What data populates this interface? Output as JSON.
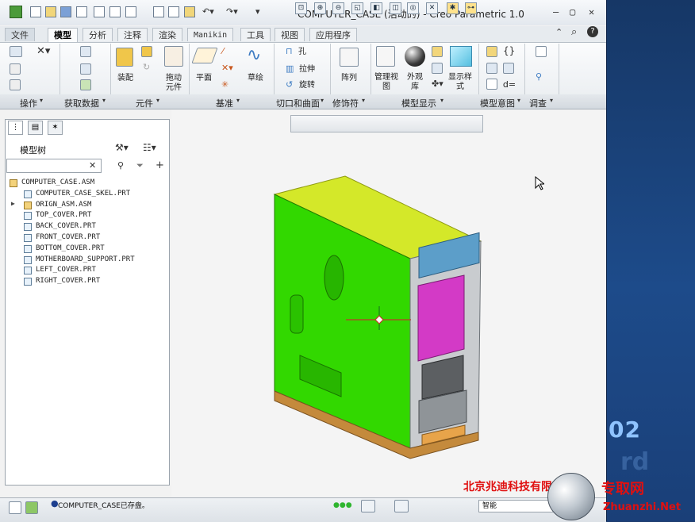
{
  "window": {
    "title": "COMPUTER_CASE (活动的) - Creo Parametric 1.0",
    "controls": [
      "—",
      "▢",
      "✕"
    ]
  },
  "tabs": [
    {
      "label": "文件",
      "active": false
    },
    {
      "label": "模型",
      "active": true
    },
    {
      "label": "分析",
      "active": false
    },
    {
      "label": "注释",
      "active": false
    },
    {
      "label": "渲染",
      "active": false
    },
    {
      "label": "Manikin",
      "active": false
    },
    {
      "label": "工具",
      "active": false
    },
    {
      "label": "视图",
      "active": false
    },
    {
      "label": "应用程序",
      "active": false
    }
  ],
  "ribbon": {
    "buttons": {
      "assemble": "装配",
      "drag": "拖动\n元件",
      "plane": "平面",
      "sketch": "草绘",
      "hole": "孔",
      "extrude": "拉伸",
      "revolve": "旋转",
      "pattern": "阵列",
      "manage_views": "管理视\n图",
      "appearance": "外观\n库",
      "display_style": "显示样\n式",
      "equation": "d="
    },
    "groups": [
      "操作",
      "获取数据",
      "元件",
      "基准",
      "切口和曲面",
      "修饰符",
      "模型显示",
      "模型意图",
      "调查"
    ]
  },
  "model_tree": {
    "title": "模型树",
    "search_placeholder": "",
    "items": [
      {
        "label": "COMPUTER_CASE.ASM",
        "type": "asm",
        "level": 0,
        "expandable": false
      },
      {
        "label": "COMPUTER_CASE_SKEL.PRT",
        "type": "prt",
        "level": 1,
        "expandable": false
      },
      {
        "label": "ORIGN_ASM.ASM",
        "type": "asm",
        "level": 1,
        "expandable": true
      },
      {
        "label": "TOP_COVER.PRT",
        "type": "prt",
        "level": 1,
        "expandable": false
      },
      {
        "label": "BACK_COVER.PRT",
        "type": "prt",
        "level": 1,
        "expandable": false
      },
      {
        "label": "FRONT_COVER.PRT",
        "type": "prt",
        "level": 1,
        "expandable": false
      },
      {
        "label": "BOTTOM_COVER.PRT",
        "type": "prt",
        "level": 1,
        "expandable": false
      },
      {
        "label": "MOTHERBOARD_SUPPORT.PRT",
        "type": "prt",
        "level": 1,
        "expandable": false
      },
      {
        "label": "LEFT_COVER.PRT",
        "type": "prt",
        "level": 1,
        "expandable": false
      },
      {
        "label": "RIGHT_COVER.PRT",
        "type": "prt",
        "level": 1,
        "expandable": false
      }
    ]
  },
  "status": {
    "message": "COMPUTER_CASE已存盘。",
    "filter_value": "智能"
  },
  "watermark": {
    "company": "北京兆迪科技有限公司",
    "site_cn": "专取网",
    "site": "Zhuanzhi.Net"
  },
  "desktop": {
    "number": "02",
    "ghost_text": "rd"
  },
  "colors": {
    "case_side": "#32d800",
    "case_top": "#d4e829",
    "case_base": "#c48a3c",
    "interior": "#d33ac6",
    "accent": "#3d7bc2"
  }
}
